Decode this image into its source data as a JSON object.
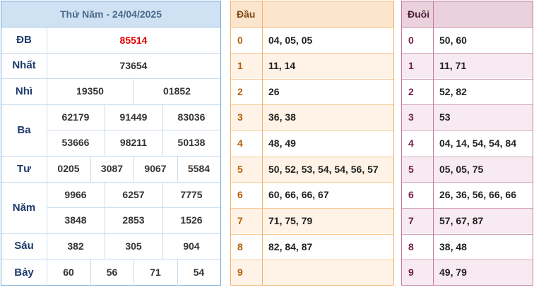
{
  "results": {
    "title": "Thứ Năm - 24/04/2025",
    "rows": [
      {
        "label": "ĐB",
        "values": [
          "85514"
        ]
      },
      {
        "label": "Nhất",
        "values": [
          "73654"
        ]
      },
      {
        "label": "Nhì",
        "values": [
          "19350",
          "01852"
        ]
      },
      {
        "label": "Ba",
        "values": [
          "62179",
          "91449",
          "83036",
          "53666",
          "98211",
          "50138"
        ]
      },
      {
        "label": "Tư",
        "values": [
          "0205",
          "3087",
          "9067",
          "5584"
        ]
      },
      {
        "label": "Năm",
        "values": [
          "9966",
          "6257",
          "7775",
          "3848",
          "2853",
          "1526"
        ]
      },
      {
        "label": "Sáu",
        "values": [
          "382",
          "305",
          "904"
        ]
      },
      {
        "label": "Bảy",
        "values": [
          "60",
          "56",
          "71",
          "54"
        ]
      }
    ],
    "special_color": "#e00000"
  },
  "dau": {
    "header": "Đầu",
    "rows": [
      {
        "digit": "0",
        "values": "04, 05, 05"
      },
      {
        "digit": "1",
        "values": "11, 14"
      },
      {
        "digit": "2",
        "values": "26"
      },
      {
        "digit": "3",
        "values": "36, 38"
      },
      {
        "digit": "4",
        "values": "48, 49"
      },
      {
        "digit": "5",
        "values": "50, 52, 53, 54, 54, 56, 57"
      },
      {
        "digit": "6",
        "values": "60, 66, 66, 67"
      },
      {
        "digit": "7",
        "values": "71, 75, 79"
      },
      {
        "digit": "8",
        "values": "82, 84, 87"
      },
      {
        "digit": "9",
        "values": ""
      }
    ]
  },
  "duoi": {
    "header": "Đuôi",
    "rows": [
      {
        "digit": "0",
        "values": "50, 60"
      },
      {
        "digit": "1",
        "values": "11, 71"
      },
      {
        "digit": "2",
        "values": "52, 82"
      },
      {
        "digit": "3",
        "values": "53"
      },
      {
        "digit": "4",
        "values": "04, 14, 54, 54, 84"
      },
      {
        "digit": "5",
        "values": "05, 05, 75"
      },
      {
        "digit": "6",
        "values": "26, 36, 56, 66, 66"
      },
      {
        "digit": "7",
        "values": "57, 67, 87"
      },
      {
        "digit": "8",
        "values": "38, 48"
      },
      {
        "digit": "9",
        "values": "49, 79"
      }
    ]
  }
}
